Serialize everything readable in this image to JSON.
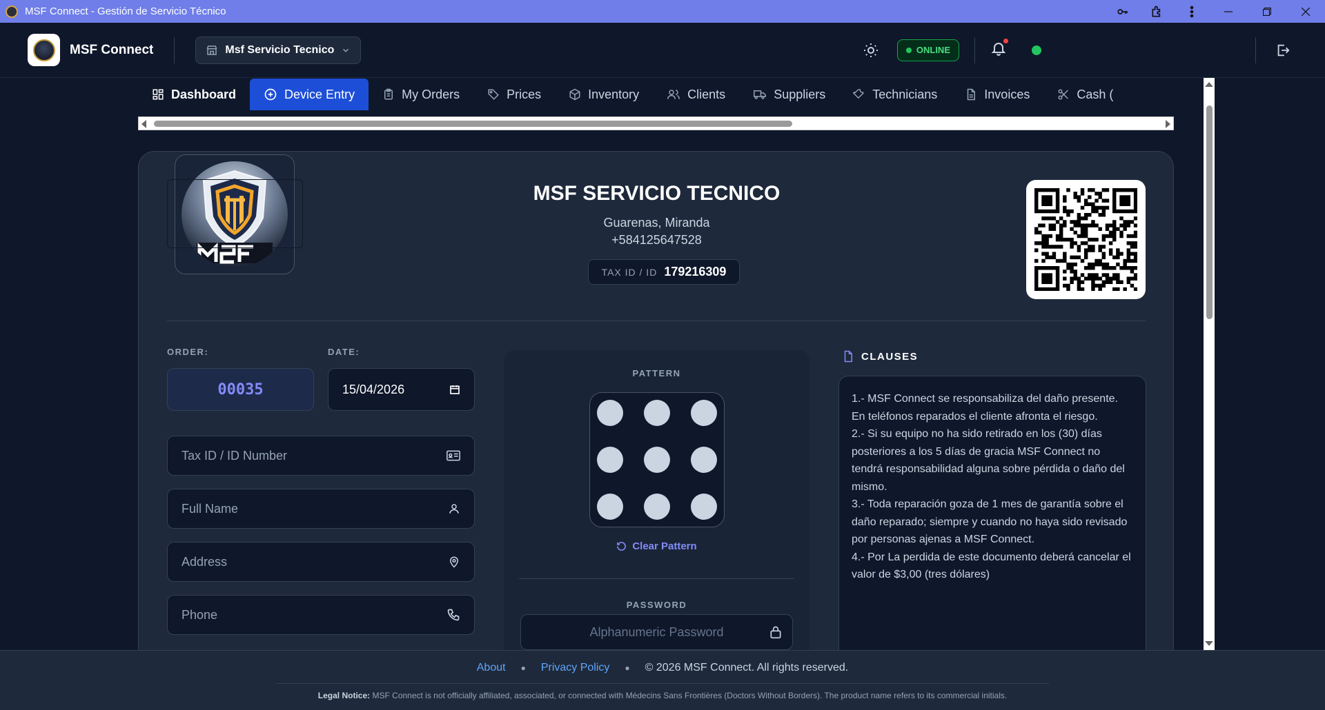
{
  "window": {
    "title": "MSF Connect - Gestión de Servicio Técnico"
  },
  "header": {
    "brand": "MSF Connect",
    "branch": "Msf Servicio Tecnico",
    "status": "ONLINE"
  },
  "nav": {
    "tabs": [
      {
        "label": "Dashboard"
      },
      {
        "label": "Device Entry"
      },
      {
        "label": "My Orders"
      },
      {
        "label": "Prices"
      },
      {
        "label": "Inventory"
      },
      {
        "label": "Clients"
      },
      {
        "label": "Suppliers"
      },
      {
        "label": "Technicians"
      },
      {
        "label": "Invoices"
      },
      {
        "label": "Cash ("
      }
    ]
  },
  "company": {
    "name": "MSF SERVICIO TECNICO",
    "city": "Guarenas, Miranda",
    "phone": "+584125647528",
    "tax_label": "TAX ID / ID",
    "tax_value": "179216309"
  },
  "form": {
    "order_label": "ORDER:",
    "order_value": "00035",
    "date_label": "DATE:",
    "date_value": "15/04/2026",
    "taxid_placeholder": "Tax ID / ID Number",
    "name_placeholder": "Full Name",
    "address_placeholder": "Address",
    "phone_placeholder": "Phone"
  },
  "pattern": {
    "label": "PATTERN",
    "clear": "Clear Pattern",
    "password_label": "PASSWORD",
    "password_placeholder": "Alphanumeric Password"
  },
  "clauses": {
    "title": "CLAUSES",
    "lines": [
      "1.- MSF Connect se responsabiliza del daño presente. En teléfonos reparados el cliente afronta el riesgo.",
      "2.- Si su equipo no ha sido retirado en los (30) días posteriores a los 5 días de gracia MSF Connect no tendrá responsabilidad alguna sobre pérdida o daño del mismo.",
      "3.- Toda reparación goza de 1 mes de garantía sobre el daño reparado; siempre y cuando no haya sido revisado por personas ajenas a MSF Connect.",
      "4.- Por La perdida de este documento deberá cancelar el valor de $3,00 (tres dólares)"
    ]
  },
  "footer": {
    "about": "About",
    "privacy": "Privacy Policy",
    "copyright": "© 2026 MSF Connect. All rights reserved.",
    "legal_label": "Legal Notice:",
    "legal_text": "MSF Connect is not officially affiliated, associated, or connected with Médecins Sans Frontières (Doctors Without Borders). The product name refers to its commercial initials."
  },
  "colors": {
    "accent": "#1d4ed8",
    "online": "#22c55e",
    "link": "#60a5fa",
    "titlebar": "#6f7ee8"
  }
}
